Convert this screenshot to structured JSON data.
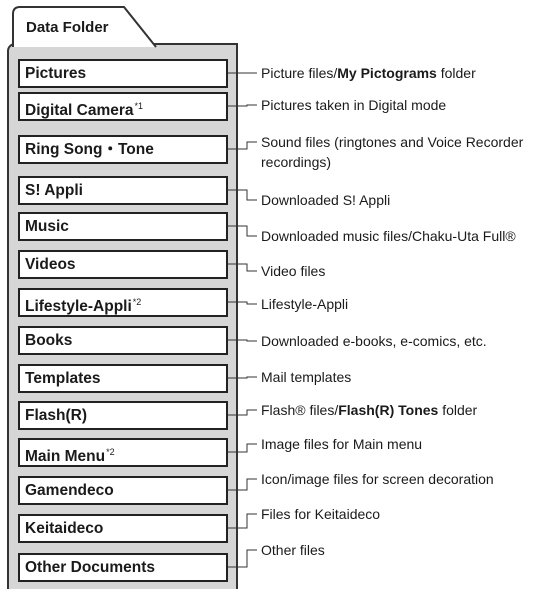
{
  "header": {
    "title": "Data Folder"
  },
  "folders": [
    {
      "label": "Pictures",
      "note": ""
    },
    {
      "label": "Digital Camera",
      "note": "*1"
    },
    {
      "label": "Ring Song・Tone",
      "note": ""
    },
    {
      "label": "S! Appli",
      "note": ""
    },
    {
      "label": "Music",
      "note": ""
    },
    {
      "label": "Videos",
      "note": ""
    },
    {
      "label": "Lifestyle-Appli",
      "note": "*2"
    },
    {
      "label": "Books",
      "note": ""
    },
    {
      "label": "Templates",
      "note": ""
    },
    {
      "label": "Flash(R)",
      "note": ""
    },
    {
      "label": "Main Menu",
      "note": "*2"
    },
    {
      "label": "Gamendeco",
      "note": ""
    },
    {
      "label": "Keitaideco",
      "note": ""
    },
    {
      "label": "Other Documents",
      "note": ""
    }
  ],
  "descriptions": [
    {
      "before": "Picture files/",
      "bold": "My Pictograms",
      "after": " folder"
    },
    {
      "before": "Pictures taken in Digital mode",
      "bold": "",
      "after": ""
    },
    {
      "before": "Sound files (ringtones and Voice Recorder recordings)",
      "bold": "",
      "after": ""
    },
    {
      "before": "Downloaded S! Appli",
      "bold": "",
      "after": ""
    },
    {
      "before": "Downloaded music files/Chaku-Uta Full®",
      "bold": "",
      "after": ""
    },
    {
      "before": "Video files",
      "bold": "",
      "after": ""
    },
    {
      "before": "Lifestyle-Appli",
      "bold": "",
      "after": ""
    },
    {
      "before": "Downloaded e-books, e-comics, etc.",
      "bold": "",
      "after": ""
    },
    {
      "before": "Mail templates",
      "bold": "",
      "after": ""
    },
    {
      "before": "Flash® files/",
      "bold": "Flash(R) Tones",
      "after": " folder"
    },
    {
      "before": "Image files for Main menu",
      "bold": "",
      "after": ""
    },
    {
      "before": "Icon/image files for screen decoration",
      "bold": "",
      "after": ""
    },
    {
      "before": "Files for Keitaideco",
      "bold": "",
      "after": ""
    },
    {
      "before": "Other files",
      "bold": "",
      "after": ""
    }
  ]
}
